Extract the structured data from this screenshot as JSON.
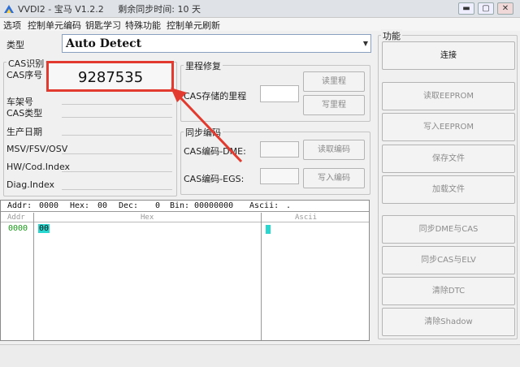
{
  "window": {
    "title": "VVDI2 - 宝马 V1.2.2",
    "sync_text": "剩余同步时间: 10 天"
  },
  "menu": [
    "选项",
    "控制单元编码",
    "钥匙学习",
    "特殊功能",
    "控制单元刷新"
  ],
  "type_label": "类型",
  "type_select": {
    "value": "Auto Detect"
  },
  "cas_group": {
    "title": "CAS识别",
    "fields": [
      {
        "label": "CAS序号",
        "value": "9287535"
      },
      {
        "label": "车架号",
        "value": ""
      },
      {
        "label": "CAS类型",
        "value": ""
      },
      {
        "label": "生产日期",
        "value": ""
      },
      {
        "label": "MSV/FSV/OSV",
        "value": ""
      },
      {
        "label": "HW/Cod.Index",
        "value": ""
      },
      {
        "label": "Diag.Index",
        "value": ""
      }
    ]
  },
  "mileage_group": {
    "title": "里程修复",
    "label": "CAS存储的里程",
    "value": "",
    "read_btn": "读里程",
    "write_btn": "写里程"
  },
  "sync_group": {
    "title": "同步编码",
    "dme_label": "CAS编码-DME:",
    "dme_value": "",
    "egs_label": "CAS编码-EGS:",
    "egs_value": "",
    "read_btn": "读取编码",
    "write_btn": "写入编码"
  },
  "function_group": {
    "title": "功能",
    "buttons": [
      "连接",
      "读取EEPROM",
      "写入EEPROM",
      "保存文件",
      "加载文件",
      "同步DME与CAS",
      "同步CAS与ELV",
      "清除DTC",
      "清除Shadow"
    ]
  },
  "hex_status": {
    "addr_label": "Addr:",
    "addr": "0000",
    "hex_label": "Hex:",
    "hex": "00",
    "dec_label": "Dec:",
    "dec": "0",
    "bin_label": "Bin:",
    "bin": "00000000",
    "ascii_label": "Ascii:",
    "ascii": "."
  },
  "hex_header": {
    "addr": "Addr",
    "hex": "Hex",
    "ascii": "Ascii"
  },
  "hex_row": {
    "addr": "0000",
    "hex": "00"
  },
  "colors": {
    "annotation_red": "#e23a2e",
    "function_title_bold": "#111111",
    "cursor_cyan": "#28d8d0",
    "addr_green": "#1a9a1a"
  }
}
